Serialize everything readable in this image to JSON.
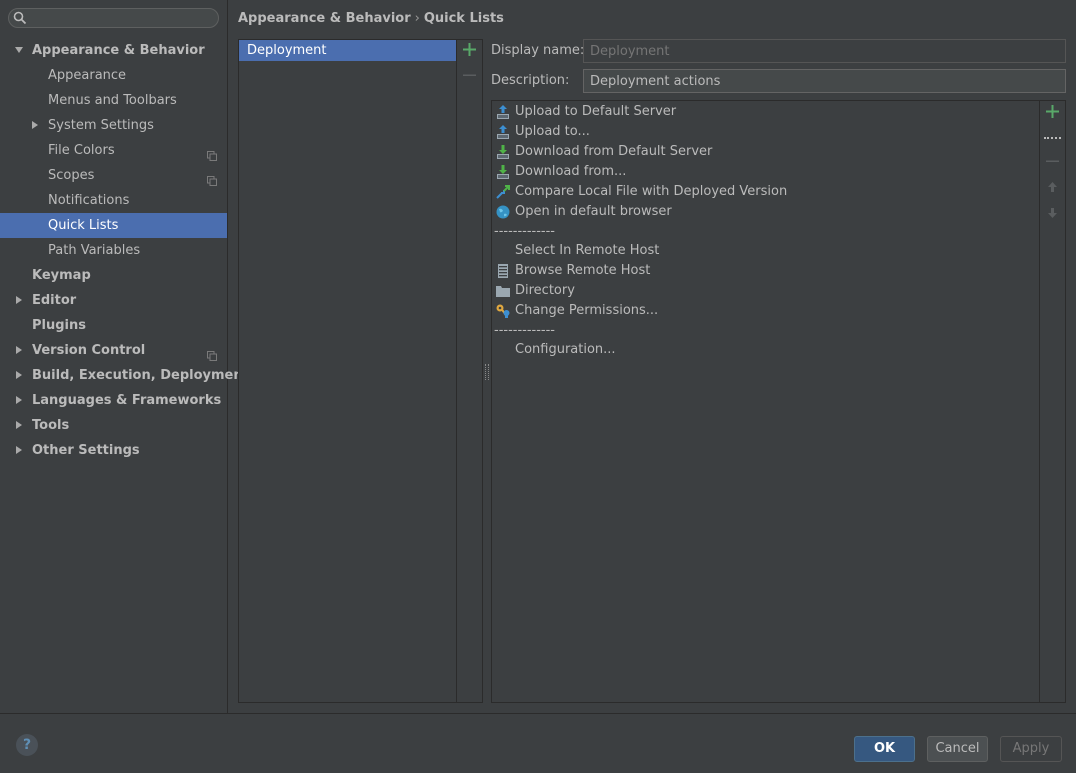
{
  "search": {
    "placeholder": ""
  },
  "sidebar": {
    "items": [
      {
        "label": "Appearance & Behavior",
        "level": 0,
        "bold": true,
        "expanded": true
      },
      {
        "label": "Appearance",
        "level": 1
      },
      {
        "label": "Menus and Toolbars",
        "level": 1
      },
      {
        "label": "System Settings",
        "level": 1,
        "collapsed": true
      },
      {
        "label": "File Colors",
        "level": 1,
        "copy": true
      },
      {
        "label": "Scopes",
        "level": 1,
        "copy": true
      },
      {
        "label": "Notifications",
        "level": 1
      },
      {
        "label": "Quick Lists",
        "level": 1,
        "selected": true
      },
      {
        "label": "Path Variables",
        "level": 1
      },
      {
        "label": "Keymap",
        "level": 0,
        "bold": true
      },
      {
        "label": "Editor",
        "level": 0,
        "bold": true,
        "collapsed": true
      },
      {
        "label": "Plugins",
        "level": 0,
        "bold": true
      },
      {
        "label": "Version Control",
        "level": 0,
        "bold": true,
        "collapsed": true,
        "copy": true
      },
      {
        "label": "Build, Execution, Deployment",
        "level": 0,
        "bold": true,
        "collapsed": true
      },
      {
        "label": "Languages & Frameworks",
        "level": 0,
        "bold": true,
        "collapsed": true
      },
      {
        "label": "Tools",
        "level": 0,
        "bold": true,
        "collapsed": true
      },
      {
        "label": "Other Settings",
        "level": 0,
        "bold": true,
        "collapsed": true
      }
    ]
  },
  "breadcrumb": {
    "parent": "Appearance & Behavior",
    "separator": "›",
    "current": "Quick Lists"
  },
  "quick_lists": {
    "items": [
      "Deployment"
    ]
  },
  "form": {
    "display_name_label": "Display name:",
    "display_name_placeholder": "Deployment",
    "description_label": "Description:",
    "description_value": "Deployment actions"
  },
  "actions": {
    "items": [
      {
        "type": "action",
        "label": "Upload to Default Server",
        "icon": "upload-icon"
      },
      {
        "type": "action",
        "label": "Upload to...",
        "icon": "upload-to-icon"
      },
      {
        "type": "action",
        "label": "Download from Default Server",
        "icon": "download-icon"
      },
      {
        "type": "action",
        "label": "Download from...",
        "icon": "download-from-icon"
      },
      {
        "type": "action",
        "label": "Compare Local File with Deployed Version",
        "icon": "compare-icon"
      },
      {
        "type": "action",
        "label": "Open in default browser",
        "icon": "globe-icon"
      },
      {
        "type": "separator",
        "label": "-------------"
      },
      {
        "type": "action",
        "label": "Select In Remote Host",
        "icon": ""
      },
      {
        "type": "action",
        "label": "Browse Remote Host",
        "icon": "server-icon"
      },
      {
        "type": "action",
        "label": "Directory",
        "icon": "folder-icon"
      },
      {
        "type": "action",
        "label": "Change Permissions...",
        "icon": "permissions-icon"
      },
      {
        "type": "separator",
        "label": "-------------"
      },
      {
        "type": "action",
        "label": "Configuration...",
        "icon": ""
      }
    ]
  },
  "buttons": {
    "ok": "OK",
    "cancel": "Cancel",
    "apply": "Apply"
  },
  "help": {
    "label": "?"
  },
  "colors": {
    "background": "#3c3f41",
    "selection": "#4b6eaf",
    "add_green": "#59a869",
    "ok_blue": "#365880"
  }
}
